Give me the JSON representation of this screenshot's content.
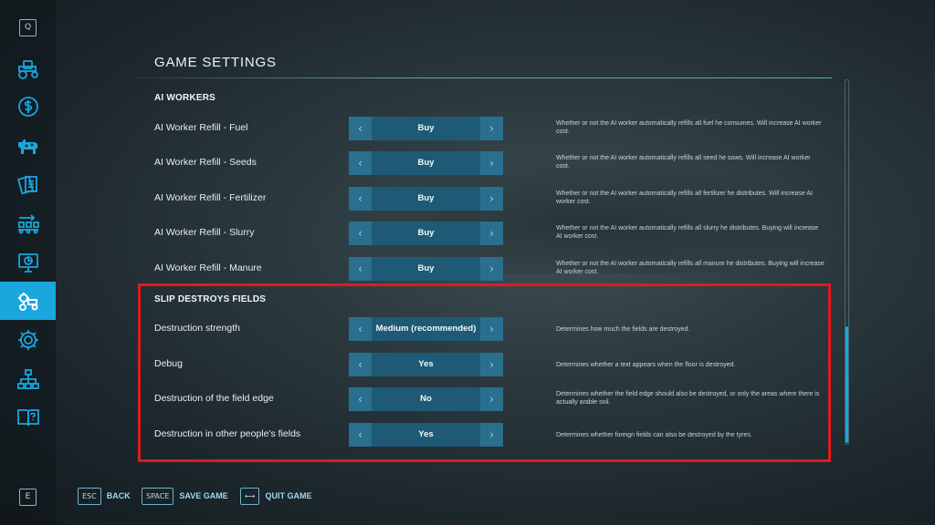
{
  "page_title": "GAME SETTINGS",
  "sidebar": {
    "top_key": "Q",
    "bottom_key": "E",
    "items": [
      {
        "icon": "tractor-icon"
      },
      {
        "icon": "dollar-icon"
      },
      {
        "icon": "animals-icon"
      },
      {
        "icon": "contracts-icon"
      },
      {
        "icon": "production-icon"
      },
      {
        "icon": "statistics-icon"
      },
      {
        "icon": "game-settings-icon",
        "active": true
      },
      {
        "icon": "gear-icon"
      },
      {
        "icon": "hierarchy-icon"
      },
      {
        "icon": "help-book-icon"
      }
    ]
  },
  "sections": [
    {
      "header": "AI WORKERS",
      "rows": [
        {
          "label": "AI Worker Refill - Fuel",
          "value": "Buy",
          "desc": "Whether or not the AI worker automatically refills all fuel he consumes. Will increase AI worker cost."
        },
        {
          "label": "AI Worker Refill - Seeds",
          "value": "Buy",
          "desc": "Whether or not the AI worker automatically refills all seed he sows. Will increase AI worker cost."
        },
        {
          "label": "AI Worker Refill - Fertilizer",
          "value": "Buy",
          "desc": "Whether or not the AI worker automatically refills all fertilizer he distributes. Will increase AI worker cost."
        },
        {
          "label": "AI Worker Refill - Slurry",
          "value": "Buy",
          "desc": "Whether or not the AI worker automatically refills all slurry he distributes. Buying will increase AI worker cost."
        },
        {
          "label": "AI Worker Refill - Manure",
          "value": "Buy",
          "desc": "Whether or not the AI worker automatically refills all manure he distributes. Buying will increase AI worker cost."
        }
      ]
    },
    {
      "header": "SLIP DESTROYS FIELDS",
      "rows": [
        {
          "label": "Destruction strength",
          "value": "Medium (recommended)",
          "desc": "Determines how much the fields are destroyed."
        },
        {
          "label": "Debug",
          "value": "Yes",
          "desc": "Determines whether a text appears when the floor is destroyed."
        },
        {
          "label": "Destruction of the field edge",
          "value": "No",
          "desc": "Determines whether the field edge should also be destroyed, or only the areas where there is actually arable soil."
        },
        {
          "label": "Destruction in other people's fields",
          "value": "Yes",
          "desc": "Determines whether foreign fields can also be destroyed by the tyres."
        }
      ]
    }
  ],
  "arrows": {
    "left": "‹",
    "right": "›"
  },
  "footer": [
    {
      "key": "ESC",
      "label": "BACK"
    },
    {
      "key": "SPACE",
      "label": "SAVE GAME"
    },
    {
      "key": "⟷",
      "label": "QUIT GAME"
    }
  ],
  "colors": {
    "accent": "#19a7de",
    "selector_value": "#1e5a75",
    "selector_arrow": "#2a6f8e",
    "highlight": "#e01b1b"
  }
}
